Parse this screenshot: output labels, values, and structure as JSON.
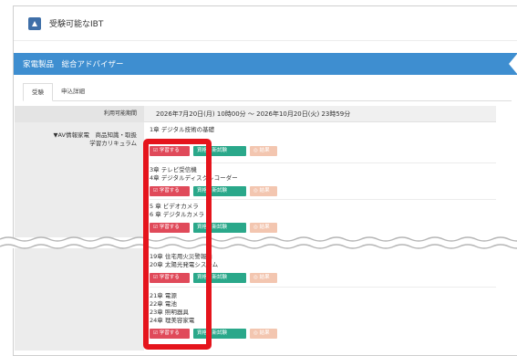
{
  "header": {
    "title": "受験可能なIBT",
    "icon": "exam-icon"
  },
  "band": {
    "title": "家電製品　総合アドバイザー"
  },
  "tabs": [
    {
      "label": "受験",
      "active": true
    },
    {
      "label": "申込詳細",
      "active": false
    }
  ],
  "period": {
    "label": "利用可能期間",
    "value": "2026年7月20日(月) 10時00分 ～ 2026年10月20日(火) 23時59分"
  },
  "category": {
    "line1": "▼AV情報家電　商品知識・取扱",
    "line2": "学習カリキュラム"
  },
  "buttons": {
    "learn": "学習する",
    "exam": "資格更新試験",
    "result": "結果"
  },
  "courses": [
    {
      "lines": [
        "1章 デジタル技術の基礎"
      ]
    },
    {
      "lines": [
        "3章 テレビ受信機",
        "4章 デジタルディスクレコーダー"
      ]
    },
    {
      "lines": [
        "5 章 ビデオカメラ",
        "6 章 デジタルカメラ"
      ]
    },
    {
      "lines": [
        "19章 住宅用火災警報器",
        "20章 太陽光発電システム"
      ]
    },
    {
      "lines": [
        "21章 電源",
        "22章 電池",
        "23章 照明器具",
        "24章 理美容家電"
      ]
    }
  ],
  "colors": {
    "band": "#3e8ed0",
    "learn": "#e04a5a",
    "exam": "#2aa88a",
    "highlight": "#e5141c"
  }
}
